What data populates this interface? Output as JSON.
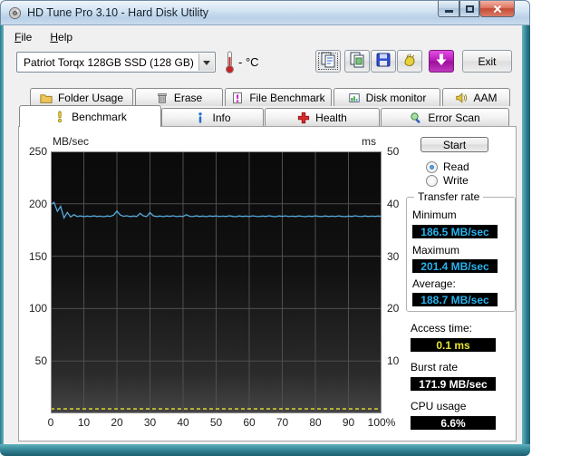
{
  "window": {
    "title": "HD Tune Pro 3.10 - Hard Disk Utility"
  },
  "menu": {
    "items": [
      {
        "label": "File"
      },
      {
        "label": "Help"
      }
    ]
  },
  "toolbar": {
    "drive_select": "Patriot Torqx 128GB SSD (128 GB)",
    "temperature_display": "- °C",
    "exit_label": "Exit"
  },
  "tabs": {
    "row1": [
      {
        "label": "Folder Usage"
      },
      {
        "label": "Erase"
      },
      {
        "label": "File Benchmark"
      },
      {
        "label": "Disk monitor"
      },
      {
        "label": "AAM"
      }
    ],
    "row2": [
      {
        "label": "Benchmark",
        "active": true
      },
      {
        "label": "Info",
        "active": false
      },
      {
        "label": "Health",
        "active": false
      },
      {
        "label": "Error Scan",
        "active": false
      }
    ]
  },
  "benchmark": {
    "start_label": "Start",
    "mode": {
      "read_label": "Read",
      "write_label": "Write",
      "selected": "Read"
    },
    "transfer_rate": {
      "title": "Transfer rate",
      "minimum_label": "Minimum",
      "minimum_value": "186.5 MB/sec",
      "maximum_label": "Maximum",
      "maximum_value": "201.4 MB/sec",
      "average_label": "Average:",
      "average_value": "188.7 MB/sec"
    },
    "access_time_label": "Access time:",
    "access_time_value": "0.1 ms",
    "burst_rate_label": "Burst rate",
    "burst_rate_value": "171.9 MB/sec",
    "cpu_usage_label": "CPU usage",
    "cpu_usage_value": "6.6%"
  },
  "colors": {
    "transfer_value_text": "#27b2ee",
    "access_value_text": "#e8e431",
    "plain_value_text": "#ffffff",
    "transfer_line": "#58abdc",
    "access_line": "#d9d431",
    "chart_grid": "#4f4f4f",
    "chart_background": "#111111",
    "close_button": "#c44a36"
  },
  "chart_data": {
    "type": "line",
    "title": "HD Tune read benchmark",
    "left_axis": {
      "label": "MB/sec",
      "ticks": [
        250,
        200,
        150,
        100,
        50
      ],
      "range": [
        0,
        250
      ]
    },
    "right_axis": {
      "label": "ms",
      "ticks": [
        50,
        40,
        30,
        20,
        10
      ],
      "range": [
        0,
        50
      ]
    },
    "x_axis": {
      "ticks": [
        "0",
        "10",
        "20",
        "30",
        "40",
        "50",
        "60",
        "70",
        "80",
        "90",
        "100%"
      ],
      "range": [
        0,
        100
      ]
    },
    "series": [
      {
        "name": "transfer_rate",
        "unit": "MB/sec",
        "color": "#58abdc",
        "values": [
          199.2,
          201.4,
          192.8,
          197.6,
          186.5,
          191.8,
          187.4,
          189.6,
          187.9,
          188.4,
          187.7,
          188.3,
          187.8,
          188.5,
          187.9,
          188.2,
          187.6,
          188.4,
          188.0,
          189.2,
          193.1,
          189.4,
          188.1,
          188.6,
          187.8,
          188.3,
          187.9,
          190.8,
          188.4,
          187.8,
          191.6,
          188.5,
          187.9,
          188.3,
          187.7,
          188.4,
          188.0,
          188.6,
          187.8,
          188.2,
          187.9,
          189.6,
          188.1,
          187.8,
          188.5,
          187.9,
          188.3,
          187.7,
          188.4,
          188.0,
          188.5,
          187.8,
          188.2,
          187.9,
          188.6,
          188.0,
          187.7,
          188.4,
          187.9,
          188.3,
          187.8,
          188.5,
          188.1,
          187.8,
          188.3,
          187.9,
          188.6,
          188.0,
          187.7,
          188.4,
          188.0,
          188.5,
          187.8,
          188.2,
          187.9,
          188.4,
          188.1,
          187.7,
          188.3,
          187.9,
          188.6,
          188.0,
          187.8,
          188.4,
          187.9,
          188.2,
          187.8,
          188.5,
          188.0,
          187.7,
          188.3,
          187.9,
          188.6,
          188.1,
          187.8,
          188.4,
          187.9,
          188.2,
          188.0,
          188.3,
          188.1
        ]
      },
      {
        "name": "access_time",
        "unit": "ms",
        "color": "#d9d431",
        "style": "dashed",
        "constant_value": 0.1
      }
    ]
  }
}
